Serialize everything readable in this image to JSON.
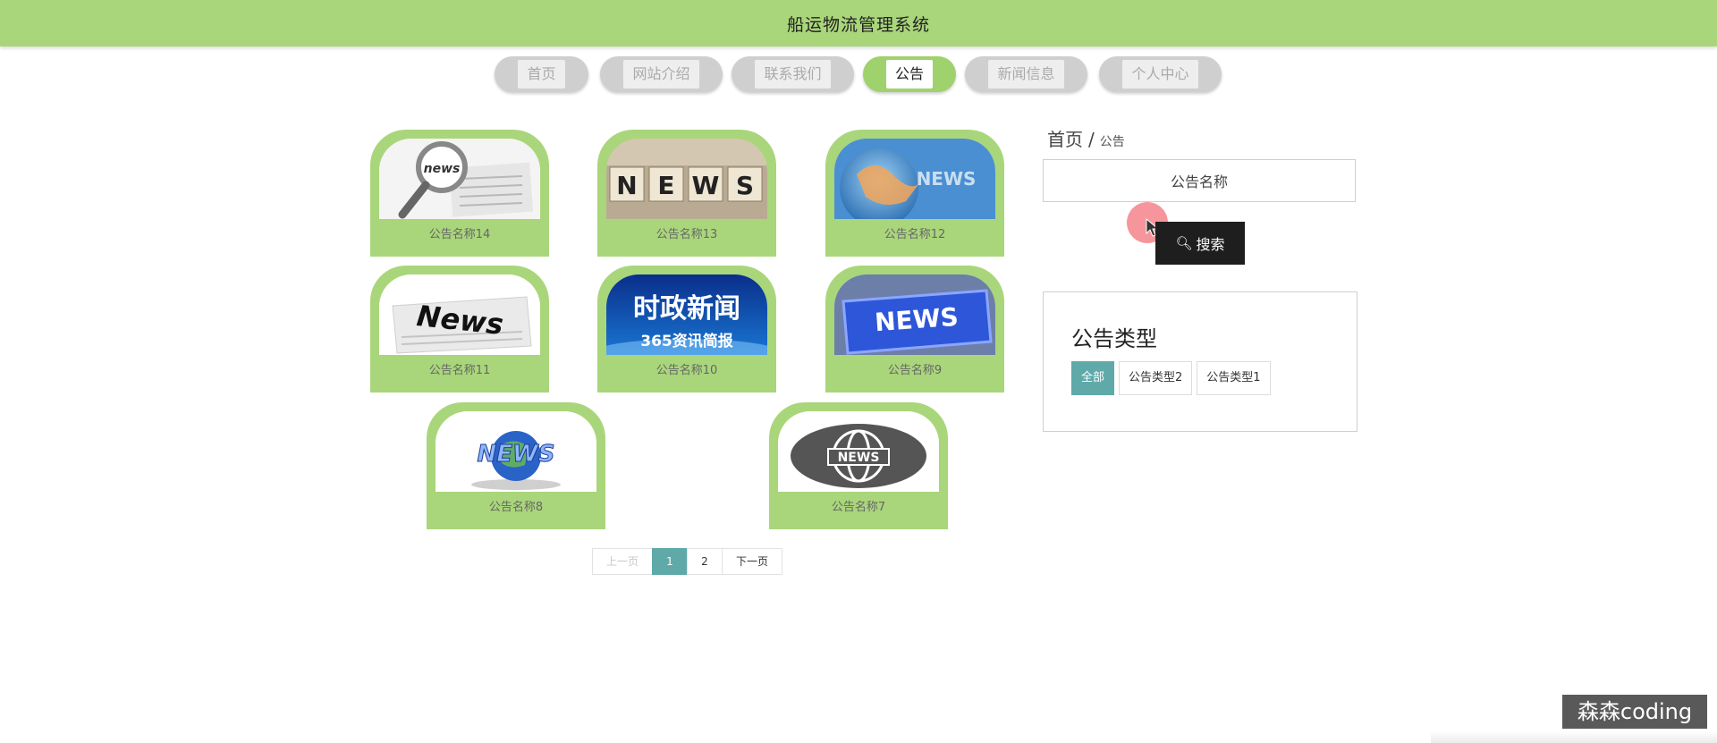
{
  "header": {
    "title": "船运物流管理系统"
  },
  "nav": {
    "items": [
      {
        "label": "首页"
      },
      {
        "label": "网站介绍"
      },
      {
        "label": "联系我们"
      },
      {
        "label": "公告"
      },
      {
        "label": "新闻信息"
      },
      {
        "label": "个人中心"
      }
    ],
    "active": "公告"
  },
  "notices": [
    {
      "name": "公告名称14",
      "image": "magnifier-news-image"
    },
    {
      "name": "公告名称13",
      "image": "news-blocks-image"
    },
    {
      "name": "公告名称12",
      "image": "globe-news-image"
    },
    {
      "name": "公告名称11",
      "image": "newspaper-news-image"
    },
    {
      "name": "公告名称10",
      "image": "political-news-image",
      "image_text": [
        "时政新闻",
        "365资讯简报"
      ]
    },
    {
      "name": "公告名称9",
      "image": "news-key-image"
    },
    {
      "name": "公告名称8",
      "image": "3d-news-globe-image"
    },
    {
      "name": "公告名称7",
      "image": "news-web-icon-image"
    }
  ],
  "pagination": {
    "prev": "上一页",
    "pages": [
      "1",
      "2"
    ],
    "current": "1",
    "next": "下一页"
  },
  "sidebar": {
    "breadcrumb": {
      "home": "首页",
      "separator": "/",
      "current": "公告"
    },
    "search": {
      "value": "公告名称",
      "button": "搜索",
      "icon": "search-icon"
    },
    "types": {
      "title": "公告类型",
      "items": [
        "全部",
        "公告类型2",
        "公告类型1"
      ],
      "active": "全部"
    }
  },
  "watermark": "森森coding",
  "colors": {
    "header_green": "#a9d67a",
    "nav_active": "#9fd16d",
    "nav_inactive": "#cfcfcf",
    "accent_teal": "#5fa9a9",
    "button_dark": "#1e1e1e"
  }
}
